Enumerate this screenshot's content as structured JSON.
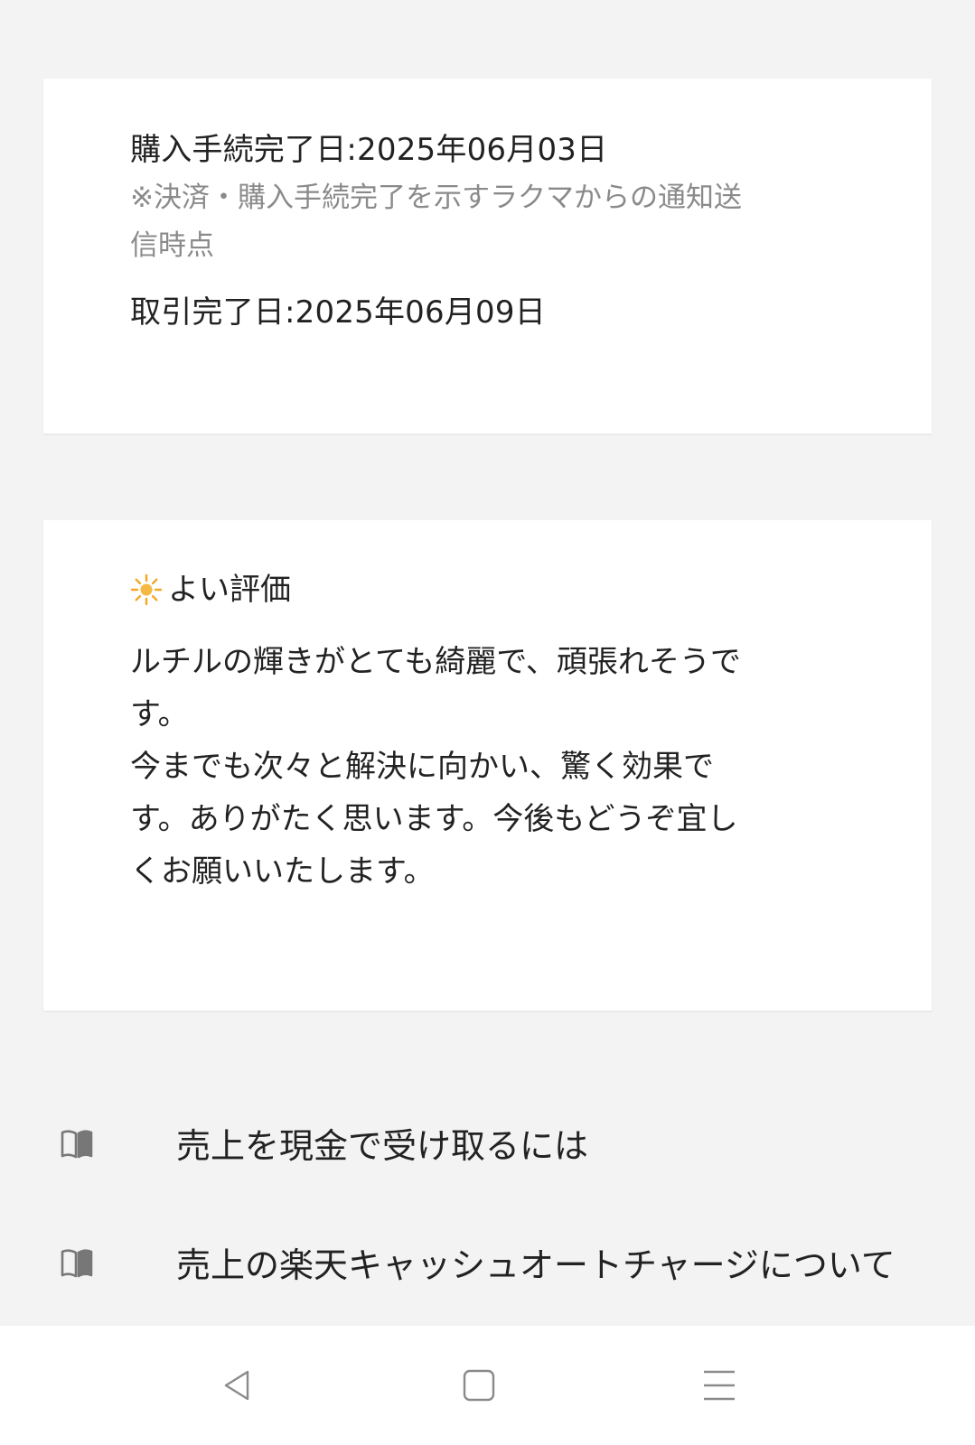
{
  "transaction": {
    "purchase_date": "購入手続完了日:2025年06月03日",
    "purchase_note_line1": "※決済・購入手続完了を示すラクマからの通知送",
    "purchase_note_line2": "信時点",
    "completion_date": "取引完了日:2025年06月09日"
  },
  "review": {
    "icon": "sun-icon",
    "title": "よい評価",
    "lines": [
      "ルチルの輝きがとても綺麗で、頑張れそうで",
      "す。",
      "今までも次々と解決に向かい、驚く効果で",
      "す。ありがたく思います。今後もどうぞ宜し",
      "くお願いいたします。"
    ]
  },
  "help_links": [
    {
      "icon": "book-icon",
      "label": "売上を現金で受け取るには"
    },
    {
      "icon": "book-icon",
      "label": "売上の楽天キャッシュオートチャージについて"
    }
  ],
  "navbar": {
    "back_icon": "back-triangle-icon",
    "home_icon": "home-square-icon",
    "menu_icon": "menu-lines-icon"
  },
  "colors": {
    "background": "#f3f3f3",
    "card": "#ffffff",
    "note_text": "#8a8a8a",
    "sun_accent": "#f5a623"
  }
}
